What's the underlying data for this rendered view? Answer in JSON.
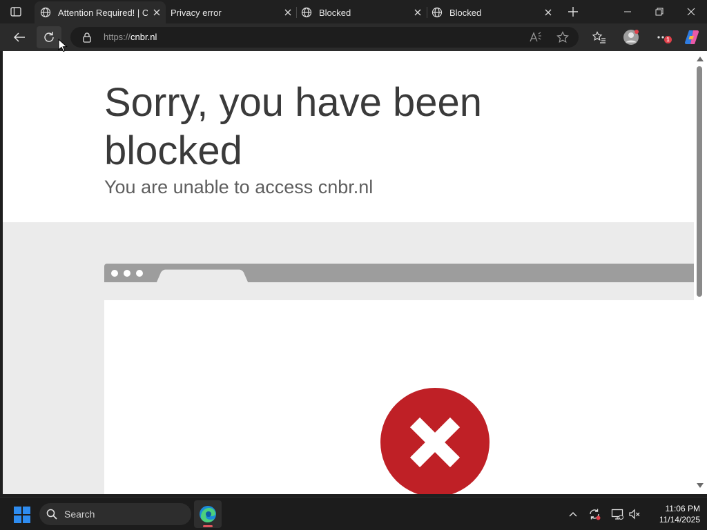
{
  "browser": {
    "tabs": [
      {
        "label": "Attention Required! | Cloudflare",
        "active": true
      },
      {
        "label": "Privacy error",
        "active": false
      },
      {
        "label": "Blocked",
        "active": false
      },
      {
        "label": "Blocked",
        "active": false
      }
    ],
    "address": {
      "scheme": "https://",
      "host": "cnbr.nl"
    },
    "notification_count": "1"
  },
  "page": {
    "headline": "Sorry, you have been blocked",
    "subline": "You are unable to access cnbr.nl"
  },
  "taskbar": {
    "search_placeholder": "Search",
    "time": "11:06 PM",
    "date": "11/14/2025"
  },
  "colors": {
    "error_red": "#bf2026",
    "edge_blue": "#1b8bd8",
    "windows_blue": "#2e8cf0"
  }
}
